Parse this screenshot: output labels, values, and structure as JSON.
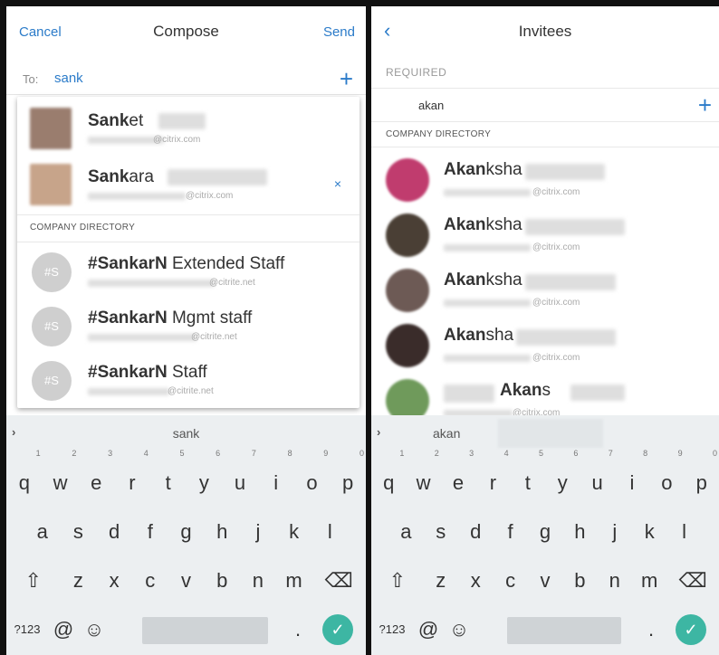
{
  "compose": {
    "header": {
      "cancel": "Cancel",
      "title": "Compose",
      "send": "Send"
    },
    "to": {
      "label": "To:",
      "value": "sank",
      "add_icon": "+"
    },
    "suggestions": [
      {
        "match": "Sank",
        "rest": "et",
        "email_domain": "@citrix.com",
        "photo_color": "#9a7d6e"
      },
      {
        "match": "Sank",
        "rest": "ara",
        "email_domain": "@citrix.com",
        "photo_color": "#c7a48a",
        "remove_icon": "×"
      }
    ],
    "directory_label": "COMPANY DIRECTORY",
    "groups": [
      {
        "initials": "#S",
        "match": "#SankarN",
        "rest": " Extended Staff",
        "email_domain": "@citrite.net"
      },
      {
        "initials": "#S",
        "match": "#SankarN",
        "rest": " Mgmt staff",
        "email_domain": "@citrite.net"
      },
      {
        "initials": "#S",
        "match": "#SankarN",
        "rest": " Staff",
        "email_domain": "@citrite.net"
      }
    ],
    "keyboard_suggestion": "sank"
  },
  "invitees": {
    "header": {
      "back_icon": "chevron-left-icon",
      "title": "Invitees"
    },
    "required_label": "REQUIRED",
    "required_value": "akan",
    "add_icon": "+",
    "directory_label": "COMPANY DIRECTORY",
    "people": [
      {
        "match": "Akan",
        "rest": "ksha",
        "email_domain": "@citrix.com",
        "photo_color": "#c03c6e"
      },
      {
        "match": "Akan",
        "rest": "ksha",
        "email_domain": "@citrix.com",
        "photo_color": "#4a3f35"
      },
      {
        "match": "Akan",
        "rest": "ksha",
        "email_domain": "@citrix.com",
        "photo_color": "#6d5a55"
      },
      {
        "match": "Akan",
        "rest": "sha",
        "email_domain": "@citrix.com",
        "photo_color": "#3a2c2a"
      },
      {
        "match": "Akan",
        "rest": "s",
        "email_domain": "@citrix.com",
        "photo_color": "#6f9a5b"
      }
    ],
    "keyboard_suggestion": "akan"
  },
  "keyboard": {
    "row1": [
      "q",
      "w",
      "e",
      "r",
      "t",
      "y",
      "u",
      "i",
      "o",
      "p"
    ],
    "row1_hints": [
      "1",
      "2",
      "3",
      "4",
      "5",
      "6",
      "7",
      "8",
      "9",
      "0"
    ],
    "row2": [
      "a",
      "s",
      "d",
      "f",
      "g",
      "h",
      "j",
      "k",
      "l"
    ],
    "row3": [
      "z",
      "x",
      "c",
      "v",
      "b",
      "n",
      "m"
    ],
    "shift_icon": "⇧",
    "backspace_icon": "⌫",
    "sym_label": "?123",
    "at_label": "@",
    "emoji_icon": "☺",
    "period_label": ".",
    "enter_icon": "✓",
    "suggestion_arrow": "›"
  },
  "colors": {
    "accent": "#2b7bc9",
    "enter": "#3db6a3"
  }
}
